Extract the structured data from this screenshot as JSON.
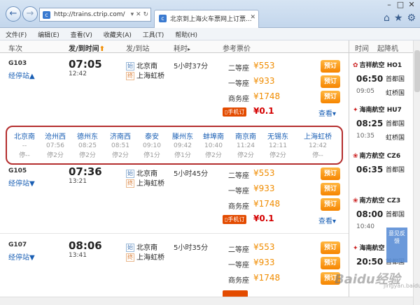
{
  "browser": {
    "url": "http://trains.ctrip.com/",
    "tab_title": "北京到上海火车票网上订票...",
    "menu": [
      "文件(F)",
      "编辑(E)",
      "查看(V)",
      "收藏夹(A)",
      "工具(T)",
      "帮助(H)"
    ]
  },
  "header": {
    "train_no": "车次",
    "time": "发/到时间",
    "station": "发/到站",
    "duration": "耗时",
    "price": "参考票价"
  },
  "trains": [
    {
      "no": "G103",
      "stops_link": "经停站",
      "depart": "07:05",
      "arrive": "12:42",
      "from": "北京南",
      "to": "上海虹桥",
      "duration": "5小时37分",
      "seats": [
        {
          "name": "二等座",
          "price": "¥553"
        },
        {
          "name": "一等座",
          "price": "¥933"
        },
        {
          "name": "商务座",
          "price": "¥1748"
        }
      ],
      "book": "预订",
      "mobile": "手机订",
      "mobile_price": "¥0.1",
      "more": "查看"
    },
    {
      "no": "G105",
      "stops_link": "经停站",
      "depart": "07:36",
      "arrive": "13:21",
      "from": "北京南",
      "to": "上海虹桥",
      "duration": "5小时45分",
      "seats": [
        {
          "name": "二等座",
          "price": "¥553"
        },
        {
          "name": "一等座",
          "price": "¥933"
        },
        {
          "name": "商务座",
          "price": "¥1748"
        }
      ],
      "book": "预订",
      "mobile": "手机订",
      "mobile_price": "¥0.1",
      "more": "查看"
    },
    {
      "no": "G107",
      "stops_link": "经停站",
      "depart": "08:06",
      "arrive": "13:41",
      "from": "北京南",
      "to": "上海虹桥",
      "duration": "5小时35分",
      "seats": [
        {
          "name": "二等座",
          "price": "¥553"
        },
        {
          "name": "一等座",
          "price": "¥933"
        },
        {
          "name": "商务座",
          "price": "¥1748"
        }
      ],
      "book": "预订"
    }
  ],
  "stops": [
    {
      "name": "北京南",
      "time": "--",
      "wait": "停--"
    },
    {
      "name": "沧州西",
      "time": "07:56",
      "wait": "停2分"
    },
    {
      "name": "德州东",
      "time": "08:25",
      "wait": "停2分"
    },
    {
      "name": "济南西",
      "time": "08:51",
      "wait": "停2分"
    },
    {
      "name": "泰安",
      "time": "09:10",
      "wait": "停1分"
    },
    {
      "name": "滕州东",
      "time": "09:42",
      "wait": "停1分"
    },
    {
      "name": "蚌埠南",
      "time": "10:40",
      "wait": "停2分"
    },
    {
      "name": "南京南",
      "time": "11:24",
      "wait": "停2分"
    },
    {
      "name": "无锡东",
      "time": "12:11",
      "wait": "停2分"
    },
    {
      "name": "上海虹桥",
      "time": "12:42",
      "wait": "停--"
    }
  ],
  "flight_panel": {
    "header_time": "时间",
    "header_from": "起降机",
    "flights": [
      {
        "airline": "吉祥航空",
        "code": "HO1",
        "dep": "06:50",
        "dep_airport": "首都国",
        "arr": "09:05",
        "arr_airport": "虹桥国",
        "logo_color": "#c8102e"
      },
      {
        "airline": "海南航空",
        "code": "HU7",
        "dep": "08:25",
        "dep_airport": "首都国",
        "arr": "10:35",
        "arr_airport": "虹桥国",
        "logo_color": "#c8102e"
      },
      {
        "airline": "南方航空",
        "code": "CZ6",
        "dep": "06:35",
        "dep_airport": "首都国",
        "arr": "",
        "arr_airport": "",
        "logo_color": "#c8102e"
      },
      {
        "airline": "南方航空",
        "code": "CZ3",
        "dep": "08:00",
        "dep_airport": "首都国",
        "arr": "10:40",
        "arr_airport": "",
        "logo_color": "#c8102e"
      },
      {
        "airline": "海南航空",
        "code": "",
        "dep": "20:50",
        "dep_airport": "首都国",
        "arr": "",
        "arr_airport": "",
        "logo_color": "#c8102e"
      }
    ]
  },
  "feedback": "意见反馈",
  "watermark": "Baidu经验",
  "watermark_url": "jingyan.baidu.com"
}
